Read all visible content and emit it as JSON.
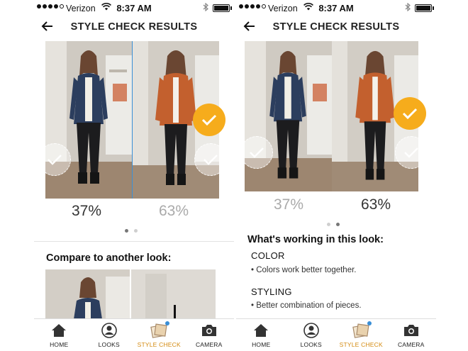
{
  "status": {
    "carrier": "Verizon",
    "time": "8:37 AM"
  },
  "header": {
    "title": "STYLE CHECK RESULTS"
  },
  "left_screen": {
    "scores": {
      "first": "37%",
      "second": "63%"
    },
    "compare_title": "Compare to another look:",
    "pager_active": 0
  },
  "right_screen": {
    "scores": {
      "first": "37%",
      "second": "63%"
    },
    "pager_active": 1,
    "working": {
      "title": "What's working in this look:",
      "sections": [
        {
          "label": "COLOR",
          "bullet": "• Colors work better together."
        },
        {
          "label": "STYLING",
          "bullet": "• Better combination of pieces."
        }
      ]
    }
  },
  "tabbar": [
    {
      "label": "HOME",
      "icon": "home-icon"
    },
    {
      "label": "LOOKS",
      "icon": "person-icon"
    },
    {
      "label": "STYLE CHECK",
      "icon": "photos-icon",
      "active": true
    },
    {
      "label": "CAMERA",
      "icon": "camera-icon"
    }
  ],
  "colors": {
    "accent": "#f6ac1c",
    "selection": "#3a8fd6",
    "active_tab": "#d48b12"
  }
}
